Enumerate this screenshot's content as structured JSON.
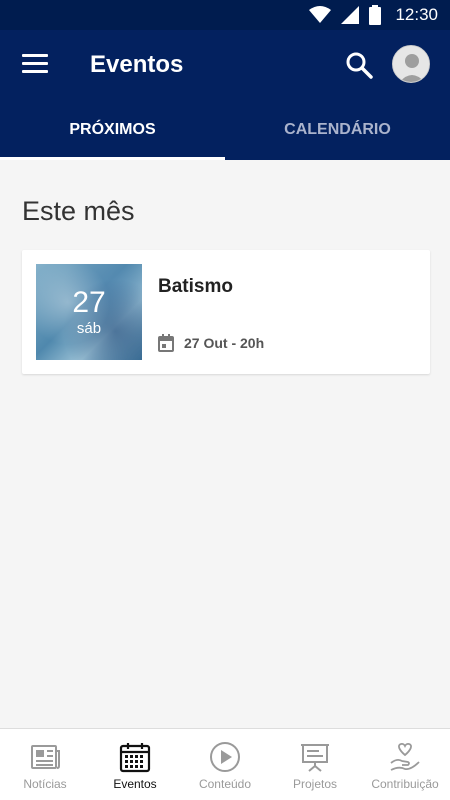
{
  "status_bar": {
    "time": "12:30",
    "icons": [
      "wifi-icon",
      "signal-icon",
      "battery-icon"
    ]
  },
  "app_bar": {
    "title": "Eventos",
    "menu_icon": "menu-icon",
    "search_icon": "search-icon",
    "avatar_icon": "avatar-icon"
  },
  "tabs": [
    {
      "label": "PRÓXIMOS",
      "active": true
    },
    {
      "label": "CALENDÁRIO",
      "active": false
    }
  ],
  "section_title": "Este mês",
  "events": [
    {
      "day": "27",
      "weekday": "sáb",
      "name": "Batismo",
      "date": "27 Out - 20h",
      "date_icon": "calendar-icon"
    }
  ],
  "bottom_nav": [
    {
      "label": "Notícias",
      "icon": "newspaper-icon",
      "active": false
    },
    {
      "label": "Eventos",
      "icon": "calendar-icon",
      "active": true
    },
    {
      "label": "Conteúdo",
      "icon": "play-icon",
      "active": false
    },
    {
      "label": "Projetos",
      "icon": "presentation-icon",
      "active": false
    },
    {
      "label": "Contribuição",
      "icon": "heart-hand-icon",
      "active": false
    }
  ],
  "colors": {
    "primary": "#03215f",
    "status_bar": "#001c4f",
    "background": "#f5f5f5",
    "nav_active": "#111111",
    "nav_inactive": "#9a9a9a"
  }
}
